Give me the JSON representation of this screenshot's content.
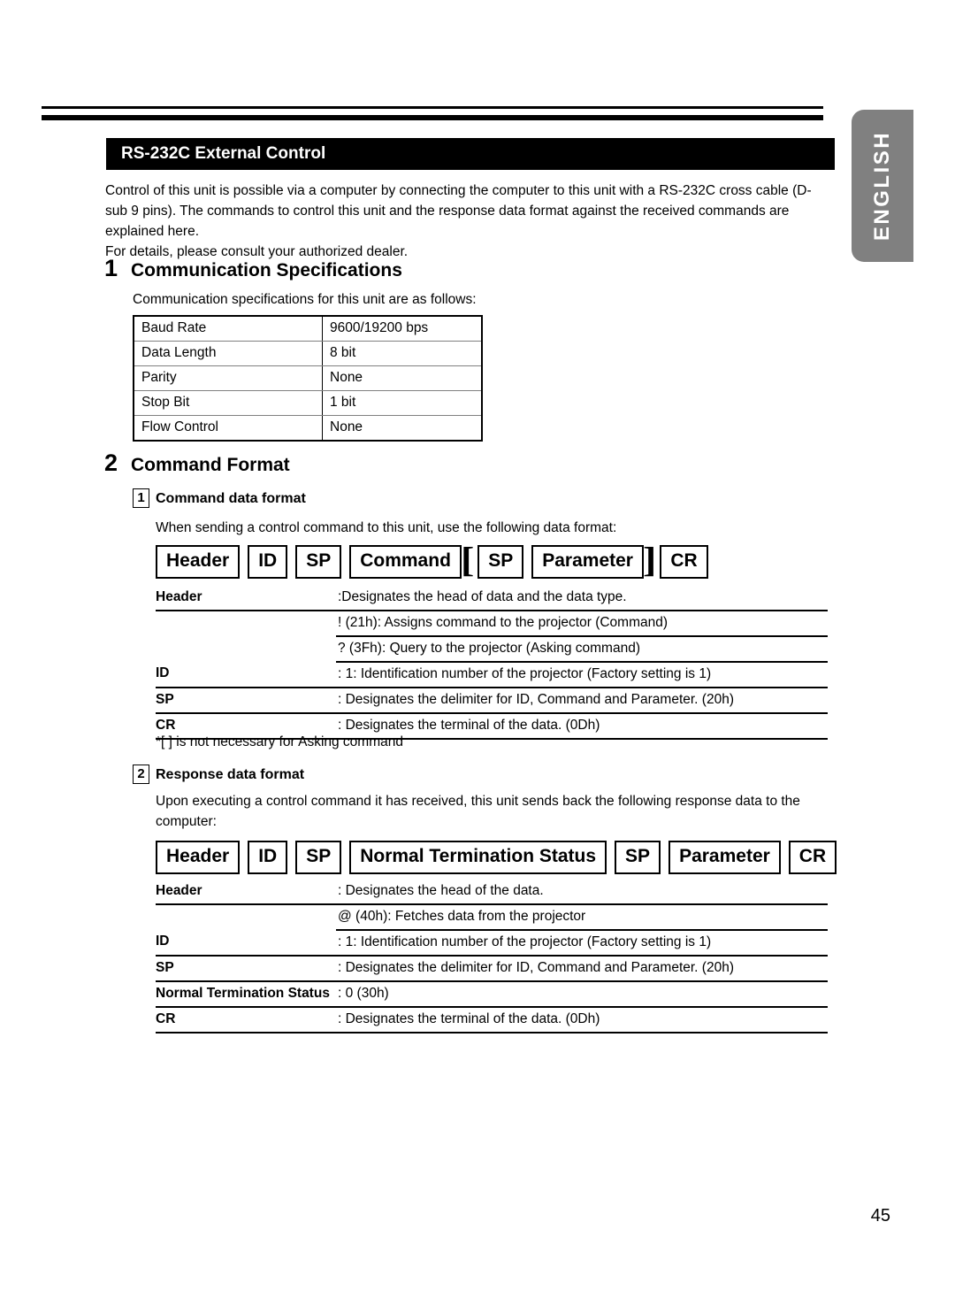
{
  "language_tab": {
    "label": "ENGLISH"
  },
  "section": {
    "title": "RS-232C External Control",
    "intro": "Control of this unit is possible via a computer by connecting the computer to this unit with a RS-232C cross cable (D-sub 9 pins). The commands to control this unit and the response data format against the received commands are explained here.",
    "intro_line2": "For details, please consult your authorized dealer."
  },
  "comm_spec": {
    "number": "1",
    "heading": "Communication Specifications",
    "lead_in": "Communication specifications for this unit are as follows:",
    "rows": [
      {
        "key": "Baud Rate",
        "value": "9600/19200 bps"
      },
      {
        "key": "Data Length",
        "value": "8 bit"
      },
      {
        "key": "Parity",
        "value": "None"
      },
      {
        "key": "Stop Bit",
        "value": "1 bit"
      },
      {
        "key": "Flow Control",
        "value": "None"
      }
    ]
  },
  "command_format": {
    "number": "2",
    "heading": "Command Format",
    "sub1": {
      "number": "1",
      "title": "Command data format",
      "lead_in": "When sending a control command to this unit, use the following data format:",
      "diagram": {
        "b1": "Header",
        "b2": "ID",
        "b3": "SP",
        "b4": "Command",
        "bracket_open": "[",
        "b5": "SP",
        "b6": "Parameter",
        "bracket_close": "]",
        "b7": "CR"
      },
      "definitions": [
        {
          "label": "Header",
          "value": ":Designates the head of data and the data type.",
          "rule": "full"
        },
        {
          "label": "",
          "value": "! (21h): Assigns command to the projector (Command)",
          "rule": "part"
        },
        {
          "label": "",
          "value": "? (3Fh): Query to the projector (Asking command)",
          "rule": "part"
        },
        {
          "label": "ID",
          "value": ": 1: Identification number of the projector (Factory setting is 1)",
          "rule": "full"
        },
        {
          "label": "SP",
          "value": ": Designates the delimiter for ID, Command and Parameter. (20h)",
          "rule": "full"
        },
        {
          "label": "CR",
          "value": ": Designates the terminal of the data. (0Dh)",
          "rule": "full"
        }
      ],
      "footnote": "*[ ] is not necessary for Asking command"
    },
    "sub2": {
      "number": "2",
      "title": "Response data format",
      "lead_in": "Upon executing a control command it has received, this unit sends back the following response data to the computer:",
      "diagram": {
        "b1": "Header",
        "b2": "ID",
        "b3": "SP",
        "b4": "Normal Termination Status",
        "b5": "SP",
        "b6": "Parameter",
        "b7": "CR"
      },
      "definitions": [
        {
          "label": "Header",
          "value": ": Designates the head of the data.",
          "rule": "full"
        },
        {
          "label": "",
          "value": "@ (40h): Fetches data from the projector",
          "rule": "part"
        },
        {
          "label": "ID",
          "value": ": 1: Identification number of the projector (Factory setting is 1)",
          "rule": "full"
        },
        {
          "label": "SP",
          "value": ": Designates the delimiter for ID, Command and Parameter. (20h)",
          "rule": "full"
        },
        {
          "label": "Normal Termination Status",
          "value": ": 0 (30h)",
          "rule": "full"
        },
        {
          "label": "CR",
          "value": ": Designates the terminal of the data. (0Dh)",
          "rule": "full"
        }
      ]
    }
  },
  "page_number": "45"
}
